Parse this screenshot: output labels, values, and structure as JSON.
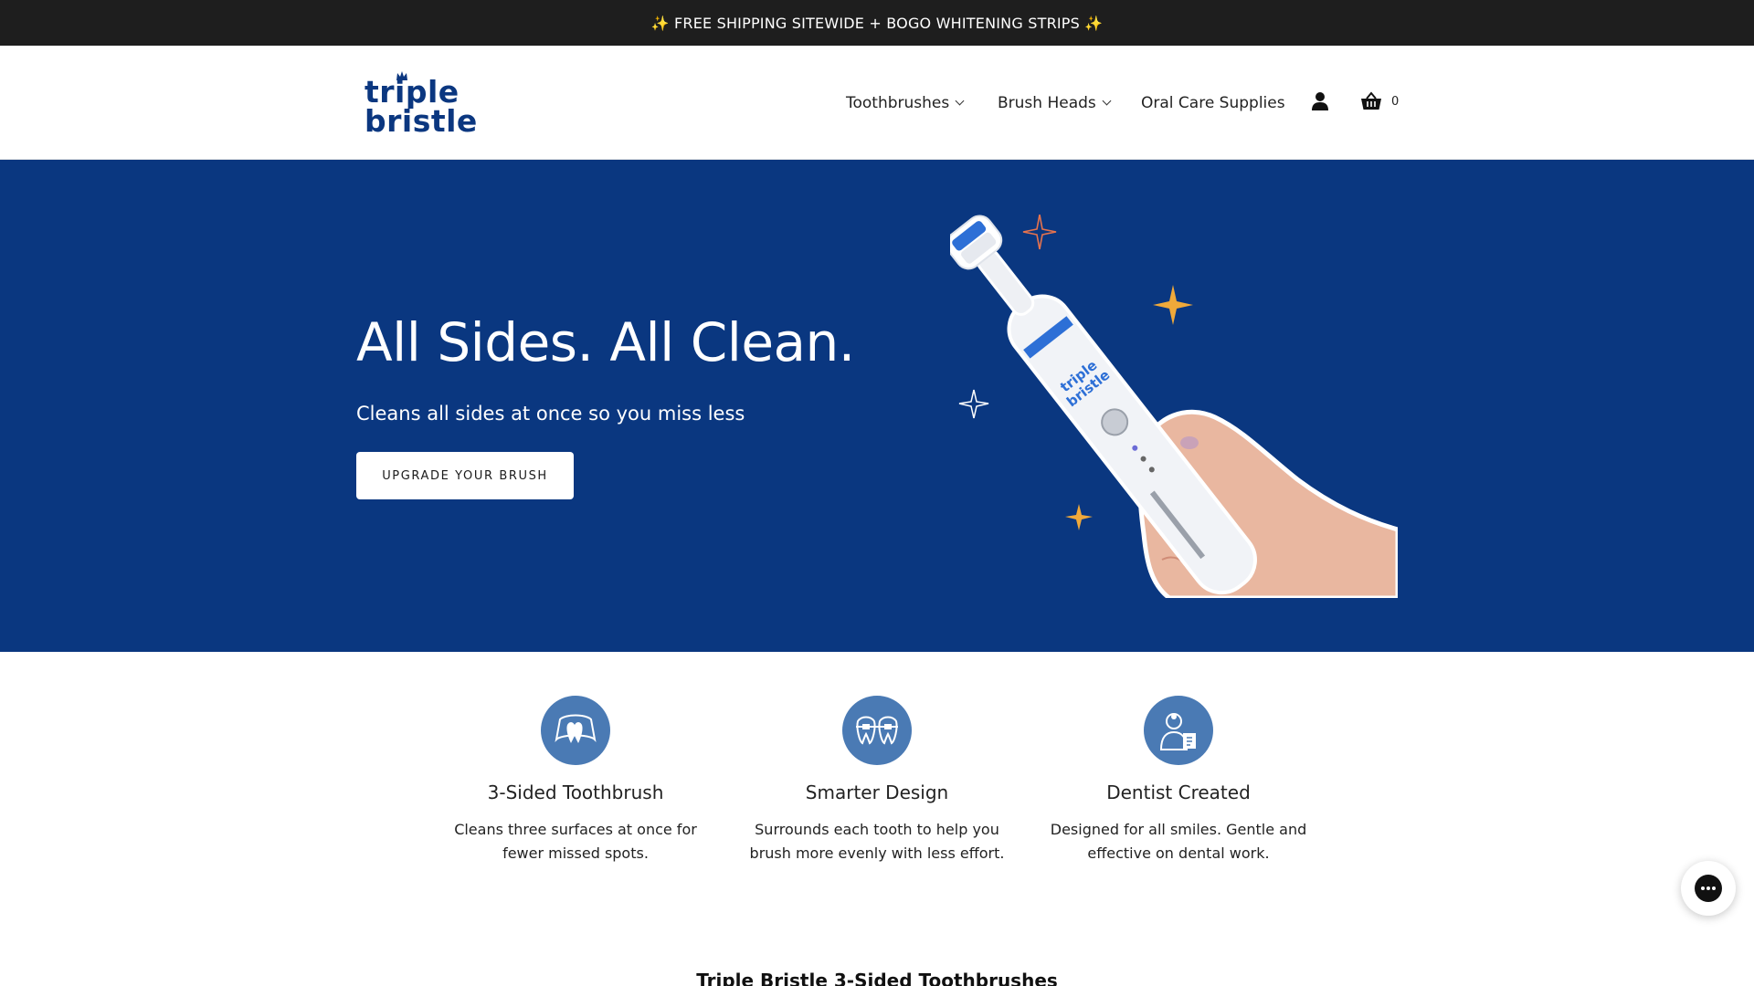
{
  "announcement": {
    "text": "✨ FREE SHIPPING SITEWIDE + BOGO WHITENING STRIPS ✨"
  },
  "header": {
    "logo_line1": "triple",
    "logo_line2": "bristle",
    "nav": [
      {
        "label": "Toothbrushes",
        "has_dropdown": true
      },
      {
        "label": "Brush Heads",
        "has_dropdown": true
      },
      {
        "label": "Oral Care Supplies",
        "has_dropdown": false
      }
    ],
    "account_icon": "user-icon",
    "cart_icon": "basket-icon",
    "cart_count": "0"
  },
  "hero": {
    "title": "All Sides. All Clean.",
    "subtitle": "Cleans all sides at once so you miss less",
    "cta": "UPGRADE YOUR BRUSH",
    "background_color": "#0a3780",
    "brush_brand_text": "triple bristle",
    "sparkle_colors": [
      "#f0a93a",
      "#e8734d",
      "#ffffff"
    ]
  },
  "features": [
    {
      "icon": "teeth-surround-icon",
      "title": "3-Sided Toothbrush",
      "text": "Cleans three surfaces at once for fewer missed spots."
    },
    {
      "icon": "braces-icon",
      "title": "Smarter Design",
      "text": "Surrounds each tooth to help you brush more evenly with less effort."
    },
    {
      "icon": "dentist-icon",
      "title": "Dentist Created",
      "text": "Designed for all smiles. Gentle and effective on dental work."
    }
  ],
  "section_title": "Triple Bristle 3-Sided Toothbrushes",
  "chat": {
    "icon": "chat-icon"
  },
  "colors": {
    "brand_blue": "#0a3780",
    "icon_circle": "#4a7ab4",
    "topbar": "#1e1e1e"
  }
}
